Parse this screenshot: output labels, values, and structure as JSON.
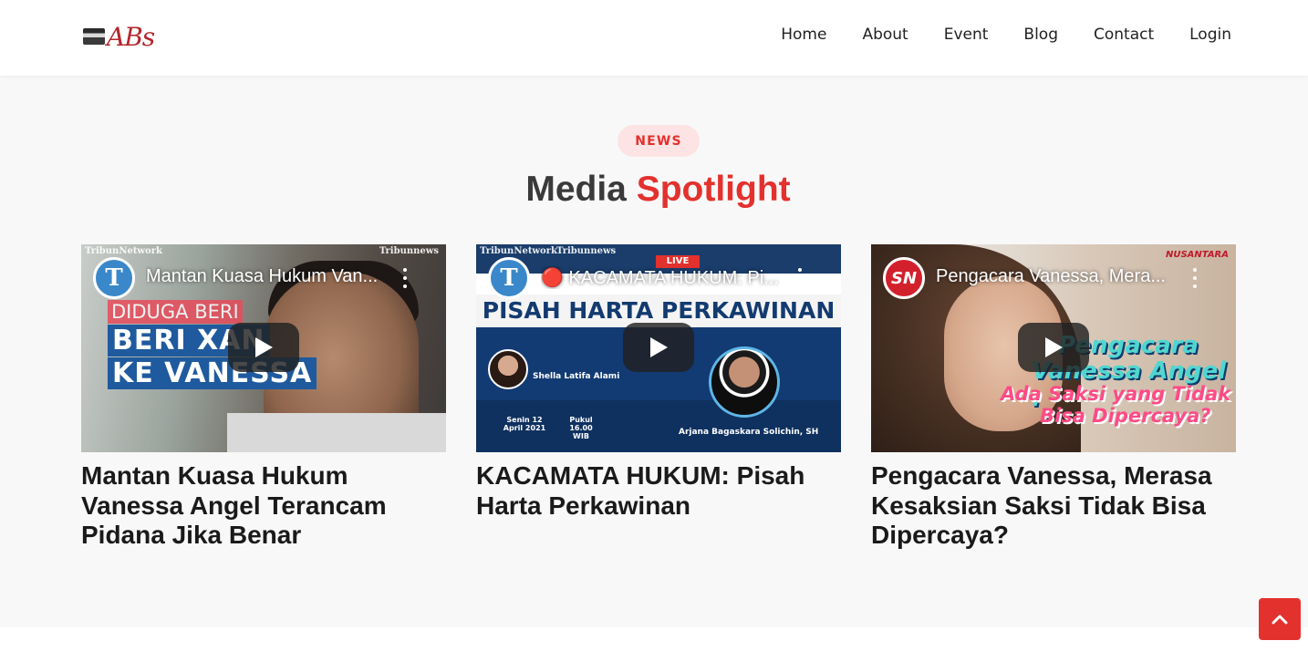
{
  "header": {
    "logo_text": "ABs",
    "nav": [
      "Home",
      "About",
      "Event",
      "Blog",
      "Contact",
      "Login"
    ]
  },
  "section": {
    "badge": "NEWS",
    "title_part1": "Media",
    "title_part2": "Spotlight"
  },
  "videos": [
    {
      "yt_title": "Mantan Kuasa Hukum Van...",
      "card_title": "Mantan Kuasa Hukum Vanessa Angel Terancam Pidana Jika Benar",
      "channel_letter": "T",
      "caption_1": "DIDUGA BERI",
      "caption_2": "BERI XAN",
      "caption_3": "KE VANESSA",
      "tag_left": "TribunNetwork",
      "tag_right": "Tribunnews"
    },
    {
      "yt_title": "🔴 KACAMATA HUKUM: Pi...",
      "card_title": "KACAMATA HUKUM: Pisah Harta Perkawinan",
      "channel_letter": "T",
      "banner": "PISAH HARTA PERKAWINAN",
      "live": "LIVE",
      "host_label": "Shella Latifa Alami",
      "date_label": "Senin 12 April 2021",
      "time_label": "Pukul 16.00 WIB",
      "guest_label": "Arjana Bagaskara Solichin, SH",
      "tag_left": "TribunNetwork",
      "tag_right": "Tribunnews"
    },
    {
      "yt_title": "Pengacara Vanessa, Mera...",
      "card_title": "Pengacara Vanessa, Merasa Kesaksian Saksi Tidak Bisa Dipercaya?",
      "channel_letter": "SN",
      "overlay_1": "Pengacara",
      "overlay_2": "Vanessa Angel :",
      "overlay_3": "Ada Saksi yang Tidak",
      "overlay_4": "Bisa Dipercaya?",
      "brand": "NUSANTARA"
    }
  ]
}
